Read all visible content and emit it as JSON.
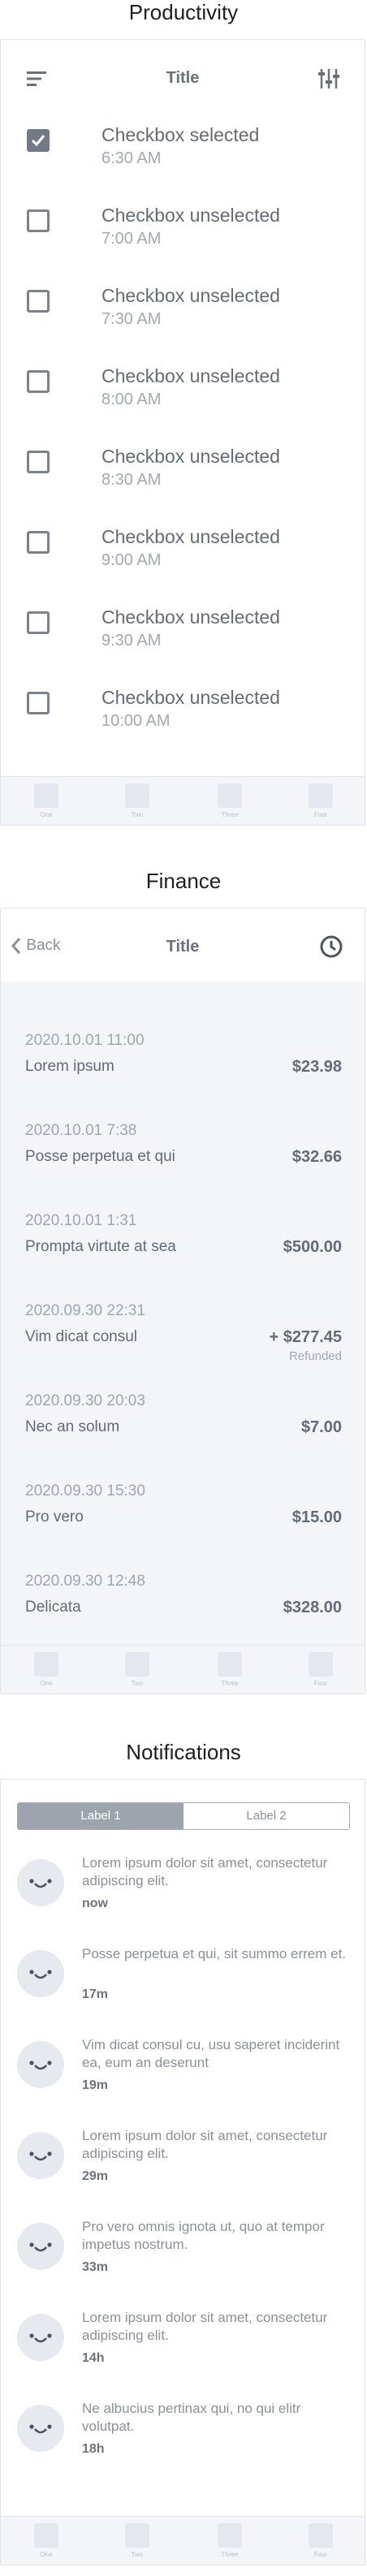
{
  "productivity": {
    "section_title": "Productivity",
    "header_title": "Title",
    "items": [
      {
        "label": "Checkbox selected",
        "time": "6:30 AM",
        "checked": true
      },
      {
        "label": "Checkbox unselected",
        "time": "7:00 AM",
        "checked": false
      },
      {
        "label": "Checkbox unselected",
        "time": "7:30 AM",
        "checked": false
      },
      {
        "label": "Checkbox unselected",
        "time": "8:00 AM",
        "checked": false
      },
      {
        "label": "Checkbox unselected",
        "time": "8:30 AM",
        "checked": false
      },
      {
        "label": "Checkbox unselected",
        "time": "9:00 AM",
        "checked": false
      },
      {
        "label": "Checkbox unselected",
        "time": "9:30 AM",
        "checked": false
      },
      {
        "label": "Checkbox unselected",
        "time": "10:00 AM",
        "checked": false
      }
    ],
    "tabs": [
      "One",
      "Two",
      "Three",
      "Four"
    ]
  },
  "finance": {
    "section_title": "Finance",
    "back_label": "Back",
    "header_title": "Title",
    "transactions": [
      {
        "date": "2020.10.01 11:00",
        "name": "Lorem ipsum",
        "amount": "$23.98",
        "note": ""
      },
      {
        "date": "2020.10.01 7:38",
        "name": "Posse perpetua et qui",
        "amount": "$32.66",
        "note": ""
      },
      {
        "date": "2020.10.01 1:31",
        "name": "Prompta virtute at sea",
        "amount": "$500.00",
        "note": ""
      },
      {
        "date": "2020.09.30 22:31",
        "name": "Vim dicat consul",
        "amount": "+ $277.45",
        "note": "Refunded"
      },
      {
        "date": "2020.09.30 20:03",
        "name": "Nec an solum",
        "amount": "$7.00",
        "note": ""
      },
      {
        "date": "2020.09.30 15:30",
        "name": "Pro vero",
        "amount": "$15.00",
        "note": ""
      },
      {
        "date": "2020.09.30 12:48",
        "name": "Delicata",
        "amount": "$328.00",
        "note": ""
      }
    ],
    "tabs": [
      "One",
      "Two",
      "Three",
      "Four"
    ]
  },
  "notifications": {
    "section_title": "Notifications",
    "segment": {
      "label1": "Label 1",
      "label2": "Label 2"
    },
    "items": [
      {
        "text": "Lorem ipsum dolor sit amet, consectetur adipiscing elit.",
        "time": "now"
      },
      {
        "text": "Posse perpetua et qui, sit summo errem et.",
        "time": "17m"
      },
      {
        "text": "Vim dicat consul cu, usu saperet inciderint ea, eum an deserunt",
        "time": "19m"
      },
      {
        "text": "Lorem ipsum dolor sit amet, consectetur adipiscing elit.",
        "time": "29m"
      },
      {
        "text": "Pro vero omnis ignota ut, quo at tempor impetus nostrum.",
        "time": "33m"
      },
      {
        "text": "Lorem ipsum dolor sit amet, consectetur adipiscing elit.",
        "time": "14h"
      },
      {
        "text": "Ne albucius pertinax qui, no qui elitr volutpat.",
        "time": "18h"
      }
    ],
    "tabs": [
      "One",
      "Two",
      "Three",
      "Four"
    ]
  },
  "icons": {
    "menu": "menu-icon",
    "filter": "sliders-icon",
    "back": "chevron-left-icon",
    "clock": "clock-icon",
    "avatar": "smiley-face-icon"
  }
}
